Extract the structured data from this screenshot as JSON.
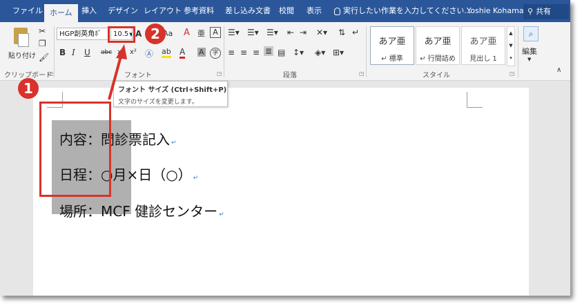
{
  "tabs": [
    {
      "label": "ファイル",
      "active": false
    },
    {
      "label": "ホーム",
      "active": true
    },
    {
      "label": "挿入",
      "active": false
    },
    {
      "label": "デザイン",
      "active": false
    },
    {
      "label": "レイアウト",
      "active": false
    },
    {
      "label": "参考資料",
      "active": false
    },
    {
      "label": "差し込み文書",
      "active": false
    },
    {
      "label": "校閲",
      "active": false
    },
    {
      "label": "表示",
      "active": false
    }
  ],
  "tell_me": "実行したい作業を入力してください...",
  "user_name": "Yoshie Kohama",
  "share_label": "共有",
  "ribbon": {
    "clipboard": {
      "paste_label": "貼り付け",
      "group_label": "クリップボード"
    },
    "font": {
      "font_name": "HGP創英角ﾎﾟ",
      "font_size": "10.5",
      "group_label": "フォント",
      "format_buttons": [
        "B",
        "I",
        "U",
        "abc",
        "x₂",
        "x²"
      ],
      "aa_label": "Aa",
      "clear_label": "A",
      "char_border_label": "A",
      "highlight_label": "ab",
      "font_color_label": "A",
      "char_shading_label": "A",
      "enclose_label": "字"
    },
    "paragraph": {
      "group_label": "段落"
    },
    "styles": {
      "items": [
        {
          "sample": "あア亜",
          "name": "↵ 標準"
        },
        {
          "sample": "あア亜",
          "name": "↵ 行間詰め"
        },
        {
          "sample": "あア亜",
          "name": "見出し 1"
        }
      ],
      "group_label": "スタイル"
    },
    "editing": {
      "label": "編集"
    }
  },
  "tooltip": {
    "title": "フォント サイズ (Ctrl+Shift+P)",
    "description": "文字のサイズを変更します。"
  },
  "document": {
    "lines": [
      {
        "text": "内容：問診票記入"
      },
      {
        "text": "日程：○月×日（○）"
      },
      {
        "text": "場所：MCF 健診センター"
      }
    ],
    "paragraph_mark": "↵"
  },
  "annotations": {
    "badge1": "1",
    "badge2": "2",
    "color": "#d8322b"
  },
  "colors": {
    "tabbar": "#2b579a",
    "ribbon": "#f3f3f3",
    "selection": "#b0b0b0"
  }
}
